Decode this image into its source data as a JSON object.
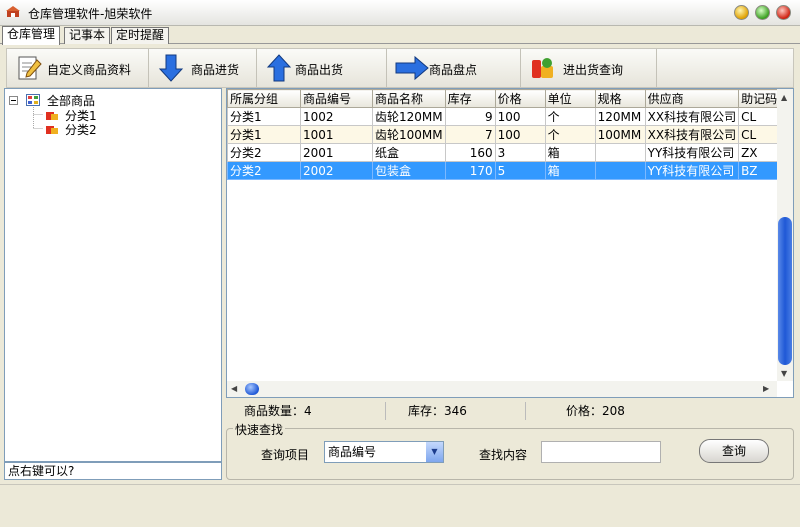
{
  "window": {
    "title": "仓库管理软件-旭荣软件"
  },
  "tabs": [
    {
      "label": "仓库管理"
    },
    {
      "label": "记事本"
    },
    {
      "label": "定时提醒"
    }
  ],
  "toolbar": {
    "custom_goods": "自定义商品资料",
    "goods_in": "商品进货",
    "goods_out": "商品出货",
    "goods_check": "商品盘点",
    "in_out_query": "进出货查询"
  },
  "tree": {
    "root": "全部商品",
    "children": [
      "分类1",
      "分类2"
    ],
    "status_hint": "点右键可以?"
  },
  "grid": {
    "headers": [
      "所属分组",
      "商品编号",
      "商品名称",
      "库存",
      "价格",
      "单位",
      "规格",
      "供应商",
      "助记码"
    ],
    "rows": [
      [
        "分类1",
        "1002",
        "齿轮120MM",
        "9",
        "100",
        "个",
        "120MM",
        "XX科技有限公司",
        "CL"
      ],
      [
        "分类1",
        "1001",
        "齿轮100MM",
        "7",
        "100",
        "个",
        "100MM",
        "XX科技有限公司",
        "CL"
      ],
      [
        "分类2",
        "2001",
        "纸盒",
        "160",
        "3",
        "箱",
        "",
        "YY科技有限公司",
        "ZX"
      ],
      [
        "分类2",
        "2002",
        "包装盒",
        "170",
        "5",
        "箱",
        "",
        "YY科技有限公司",
        "BZ"
      ]
    ]
  },
  "summary": {
    "count_label": "商品数量：",
    "count_value": "4",
    "stock_label": "库存：",
    "stock_value": "346",
    "price_label": "价格：",
    "price_value": "208"
  },
  "quick_search": {
    "legend": "快速查找",
    "item_label": "查询项目",
    "item_value": "商品编号",
    "content_label": "查找内容",
    "content_value": "",
    "button": "查询"
  }
}
